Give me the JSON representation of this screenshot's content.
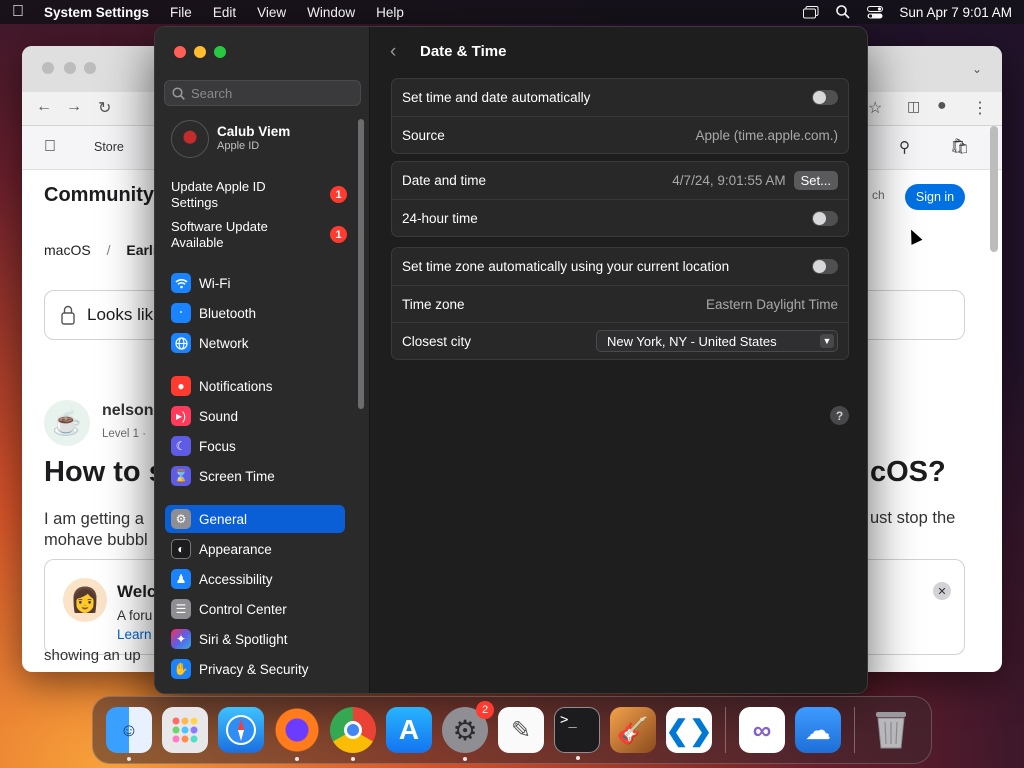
{
  "menubar": {
    "app_name": "System Settings",
    "menus": [
      "File",
      "Edit",
      "View",
      "Window",
      "Help"
    ],
    "datetime": "Sun Apr 7  9:01 AM"
  },
  "browser": {
    "nav_store": "Store",
    "community": "Community",
    "search": "ch",
    "sign_in": "Sign in",
    "breadcrumb_1": "macOS",
    "breadcrumb_sep": "/",
    "breadcrumb_2": "Earlie",
    "lock_text": "Looks lik",
    "username": "nelson",
    "level": "Level 1  ·",
    "title_left": "How to s",
    "title_right": "cOS?",
    "body_left_1": "I am getting a",
    "body_left_2": "mohave bubbl",
    "body_right": "ust stop the",
    "welcome_title": "Welc",
    "welcome_sub": "A foru",
    "welcome_link": "Learn",
    "showing": "showing an up"
  },
  "settings": {
    "search_placeholder": "Search",
    "profile_name": "Calub Viem",
    "profile_sub": "Apple ID",
    "notices": [
      {
        "label": "Update Apple ID Settings",
        "badge": "1"
      },
      {
        "label": "Software Update Available",
        "badge": "1"
      }
    ],
    "sidebar": [
      {
        "label": "Wi-Fi",
        "icon": "wifi-icon",
        "color": "#1a84ff"
      },
      {
        "label": "Bluetooth",
        "icon": "bluetooth-icon",
        "color": "#1a84ff"
      },
      {
        "label": "Network",
        "icon": "globe-icon",
        "color": "#1a84ff"
      },
      {
        "label": "Notifications",
        "icon": "bell-icon",
        "color": "#ff3b30"
      },
      {
        "label": "Sound",
        "icon": "speaker-icon",
        "color": "#ff3b5c"
      },
      {
        "label": "Focus",
        "icon": "moon-icon",
        "color": "#5e5ce6"
      },
      {
        "label": "Screen Time",
        "icon": "hourglass-icon",
        "color": "#5e5ce6"
      },
      {
        "label": "General",
        "icon": "gear-icon",
        "color": "#8e8e93"
      },
      {
        "label": "Appearance",
        "icon": "appearance-icon",
        "color": "#1c1c1e"
      },
      {
        "label": "Accessibility",
        "icon": "accessibility-icon",
        "color": "#1a84ff"
      },
      {
        "label": "Control Center",
        "icon": "control-center-icon",
        "color": "#8e8e93"
      },
      {
        "label": "Siri & Spotlight",
        "icon": "siri-icon",
        "color": "#b73bd8"
      },
      {
        "label": "Privacy & Security",
        "icon": "hand-icon",
        "color": "#1a84ff"
      }
    ],
    "selected": "General",
    "page_title": "Date & Time",
    "rows": {
      "auto_time": "Set time and date automatically",
      "source_label": "Source",
      "source_value": "Apple (time.apple.com.)",
      "date_time_label": "Date and time",
      "date_time_value": "4/7/24, 9:01:55 AM",
      "set_button": "Set...",
      "hour24": "24-hour time",
      "auto_tz": "Set time zone automatically using your current location",
      "tz_label": "Time zone",
      "tz_value": "Eastern Daylight Time",
      "city_label": "Closest city",
      "city_value": "New York, NY - United States"
    },
    "toggles": {
      "auto_time": false,
      "hour24": false,
      "auto_tz": false
    },
    "help": "?"
  },
  "dock": {
    "apps": [
      "Finder",
      "Launchpad",
      "Safari",
      "Firefox",
      "Chrome",
      "App Store",
      "System Settings",
      "TextEdit",
      "Terminal",
      "GarageBand",
      "VS Code",
      "Visual Studio",
      "Weather",
      "Trash"
    ],
    "settings_badge": "2"
  }
}
